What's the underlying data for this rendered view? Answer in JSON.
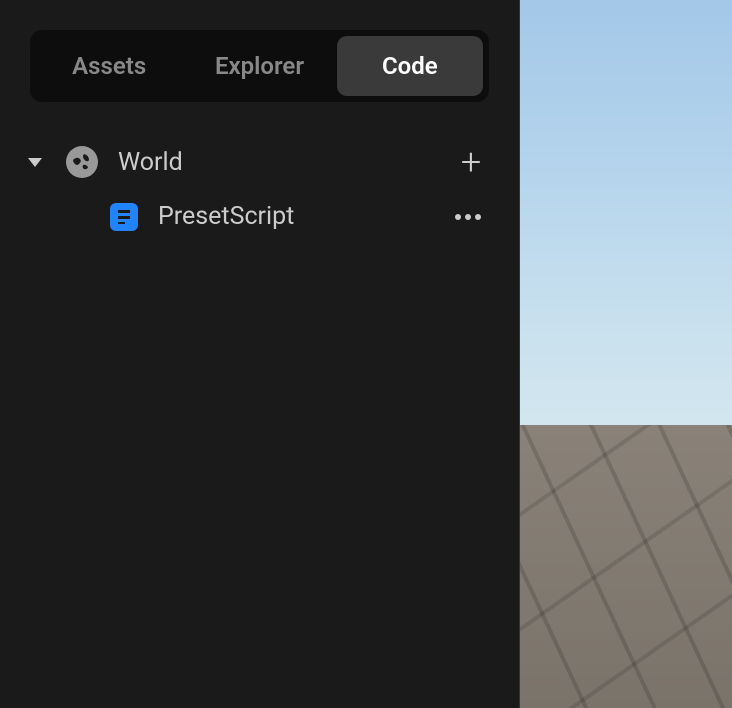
{
  "tabs": {
    "assets": "Assets",
    "explorer": "Explorer",
    "code": "Code",
    "active": "code"
  },
  "tree": {
    "root": {
      "label": "World",
      "expanded": true
    },
    "children": [
      {
        "label": "PresetScript",
        "type": "script"
      }
    ]
  }
}
